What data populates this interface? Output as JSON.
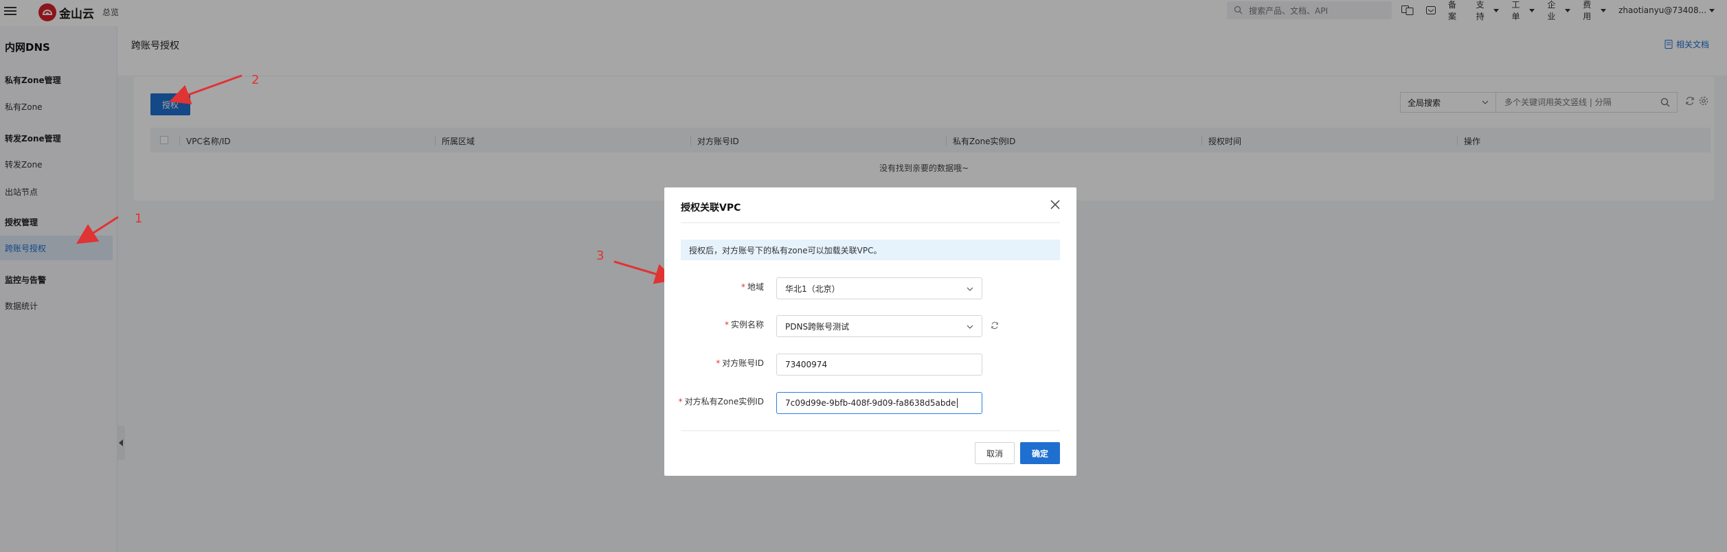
{
  "topbar": {
    "brand": "金山云",
    "home_link": "总览",
    "search_placeholder": "搜索产品、文档、API",
    "menu": {
      "beian": "备案",
      "support": "支持",
      "ticket": "工单",
      "enterprise": "企业",
      "billing": "费用",
      "user": "zhaotianyu@73408..."
    }
  },
  "sidebar": {
    "title": "内网DNS",
    "groups": [
      {
        "label": "私有Zone管理",
        "items": [
          "私有Zone"
        ]
      },
      {
        "label": "转发Zone管理",
        "items": [
          "转发Zone",
          "出站节点"
        ]
      },
      {
        "label": "授权管理",
        "items": [
          "跨账号授权"
        ]
      },
      {
        "label": "监控与告警",
        "items": [
          "数据统计"
        ]
      }
    ]
  },
  "main": {
    "page_title": "跨账号授权",
    "doc_link": "相关文档",
    "authorize_button": "授权",
    "scope_select": "全局搜索",
    "keyword_placeholder": "多个关键词用英文竖线 | 分隔",
    "table_headers": [
      "VPC名称/ID",
      "所属区域",
      "对方账号ID",
      "私有Zone实例ID",
      "授权时间",
      "操作"
    ],
    "empty_text": "没有找到亲要的数据哦~"
  },
  "modal": {
    "title": "授权关联VPC",
    "info": "授权后，对方账号下的私有zone可以加载关联VPC。",
    "fields": {
      "region": {
        "label": "地域",
        "value": "华北1（北京）"
      },
      "instance": {
        "label": "实例名称",
        "value": "PDNS跨账号测试"
      },
      "account": {
        "label": "对方账号ID",
        "value": "73400974"
      },
      "zone_id": {
        "label": "对方私有Zone实例ID",
        "value": "7c09d99e-9bfb-408f-9d09-fa8638d5abde"
      }
    },
    "cancel": "取消",
    "confirm": "确定"
  },
  "annotations": [
    "1",
    "2",
    "3"
  ],
  "colors": {
    "primary": "#1f6fd0",
    "brand": "#d71f2a",
    "annotation": "#e03333"
  }
}
